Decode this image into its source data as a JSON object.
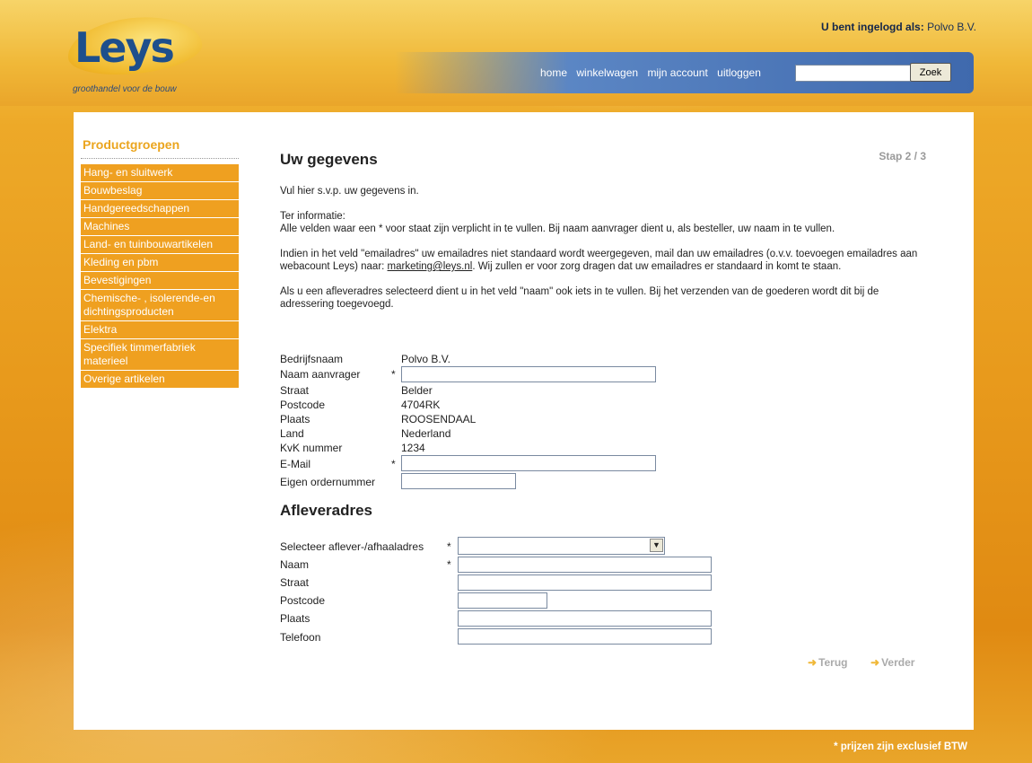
{
  "header": {
    "logo_text": "Leys",
    "tagline": "groothandel voor de bouw",
    "login_label": "U bent ingelogd als:",
    "login_user": "Polvo B.V."
  },
  "nav": {
    "links": [
      "home",
      "winkelwagen",
      "mijn account",
      "uitloggen"
    ],
    "search_placeholder": "",
    "search_button": "Zoek"
  },
  "sidebar": {
    "title": "Productgroepen",
    "items": [
      "Hang- en sluitwerk",
      "Bouwbeslag",
      "Handgereedschappen",
      "Machines",
      "Land- en tuinbouwartikelen",
      "Kleding en pbm",
      "Bevestigingen",
      "Chemische- , isolerende-en dichtingsproducten",
      "Elektra",
      "Specifiek timmerfabriek materieel",
      "Overige artikelen"
    ]
  },
  "main": {
    "title": "Uw gegevens",
    "step": "Stap 2 / 3",
    "intro": "Vul hier s.v.p. uw gegevens in.",
    "info_heading": "Ter informatie:",
    "info_text": "Alle velden waar een * voor staat zijn verplicht in te vullen. Bij naam aanvrager dient u, als besteller, uw naam in te vullen.",
    "email_text_before": "Indien in het veld \"emailadres\" uw emailadres niet standaard wordt weergegeven, mail dan uw emailadres (o.v.v. toevoegen emailadres aan webacount Leys) naar: ",
    "email_link": "marketing@leys.nl",
    "email_text_after": ". Wij zullen er voor zorg dragen dat uw emailadres er standaard in komt te staan.",
    "delivery_text": "Als u een afleveradres selecteerd dient u in het veld \"naam\" ook iets in te vullen. Bij het verzenden van de goederen wordt dit bij de adressering toegevoegd."
  },
  "company": {
    "fields": [
      {
        "label": "Bedrijfsnaam",
        "value": "Polvo B.V."
      },
      {
        "label": "Naam aanvrager",
        "value": "",
        "required": "*"
      },
      {
        "label": "Straat",
        "value": "Belder"
      },
      {
        "label": "Postcode",
        "value": "4704RK"
      },
      {
        "label": "Plaats",
        "value": "ROOSENDAAL"
      },
      {
        "label": "Land",
        "value": "Nederland"
      },
      {
        "label": "KvK nummer",
        "value": "1234"
      },
      {
        "label": "E-Mail",
        "value": "",
        "required": "*"
      },
      {
        "label": "Eigen ordernummer",
        "value": ""
      }
    ]
  },
  "delivery": {
    "title": "Afleveradres",
    "fields": [
      {
        "label": "Selecteer aflever-/afhaaladres",
        "value": "",
        "required": "*"
      },
      {
        "label": "Naam",
        "value": "",
        "required": "*"
      },
      {
        "label": "Straat",
        "value": ""
      },
      {
        "label": "Postcode",
        "value": ""
      },
      {
        "label": "Plaats",
        "value": ""
      },
      {
        "label": "Telefoon",
        "value": ""
      }
    ]
  },
  "actions": {
    "back": "Terug",
    "next": "Verder"
  },
  "footer": {
    "note": "* prijzen zijn exclusief BTW"
  },
  "colors": {
    "brand_blue": "#1e4f8c",
    "accent_orange": "#efa020",
    "nav_blue": "#3f69ad"
  }
}
